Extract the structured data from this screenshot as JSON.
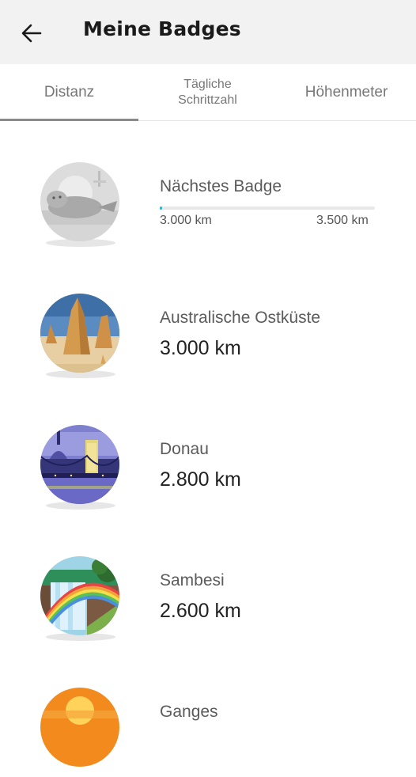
{
  "header": {
    "title": "Meine Badges",
    "back_icon": "arrow-left-icon"
  },
  "tabs": [
    {
      "label": "Distanz",
      "active": true
    },
    {
      "label": "Tägliche Schrittzahl",
      "line1": "Tägliche",
      "line2": "Schrittzahl",
      "active": false
    },
    {
      "label": "Höhenmeter",
      "active": false
    }
  ],
  "next_badge": {
    "label": "Nächstes Badge",
    "from": "3.000 km",
    "to": "3.500 km",
    "progress": 0.01,
    "icon": "seal-badge-icon"
  },
  "badges": [
    {
      "name": "Australische Ostküste",
      "distance": "3.000 km",
      "icon": "australia-rocks-badge-icon"
    },
    {
      "name": "Donau",
      "distance": "2.800 km",
      "icon": "danube-bridge-badge-icon"
    },
    {
      "name": "Sambesi",
      "distance": "2.600 km",
      "icon": "zambezi-waterfall-badge-icon"
    },
    {
      "name": "Ganges",
      "distance": "",
      "icon": "ganges-sunset-badge-icon"
    }
  ],
  "colors": {
    "progress": "#29b6d6",
    "appbar": "#f2f2f2"
  }
}
